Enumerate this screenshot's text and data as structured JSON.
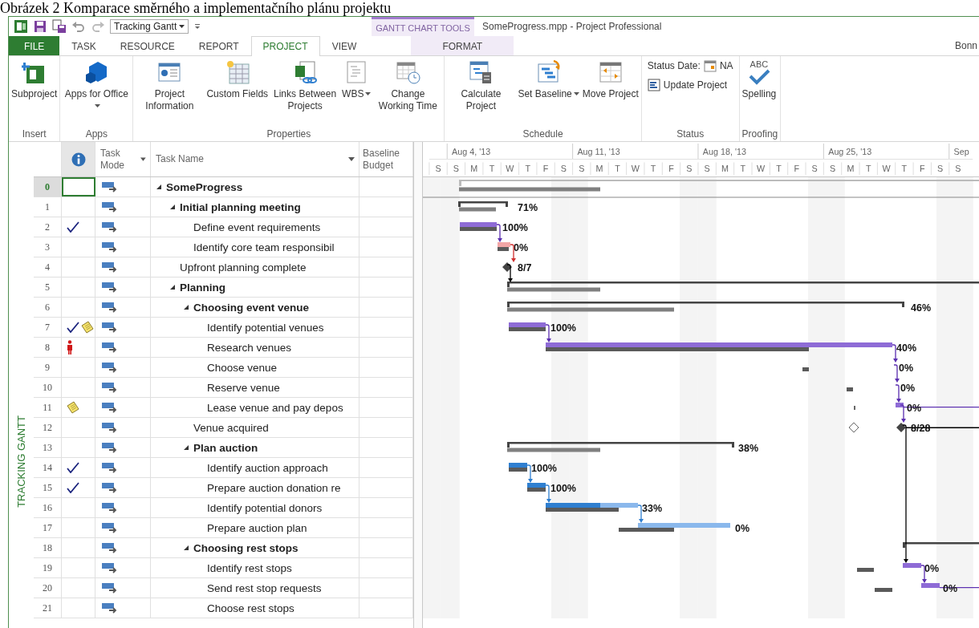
{
  "caption": "Obrázek 2 Komparace směrného a implementačního plánu projektu",
  "view_selector": "Tracking Gantt",
  "contextual_group": "GANTT CHART TOOLS",
  "window_title": "SomeProgress.mpp - Project Professional",
  "user": "Bonn",
  "tabs": [
    {
      "label": "FILE",
      "kind": "file",
      "selected": false
    },
    {
      "label": "TASK",
      "kind": "normal",
      "selected": false
    },
    {
      "label": "RESOURCE",
      "kind": "normal",
      "selected": false
    },
    {
      "label": "REPORT",
      "kind": "normal",
      "selected": false
    },
    {
      "label": "PROJECT",
      "kind": "normal",
      "selected": true
    },
    {
      "label": "VIEW",
      "kind": "normal",
      "selected": false
    },
    {
      "label": "FORMAT",
      "kind": "contextual",
      "selected": false
    }
  ],
  "ribbon_groups": [
    {
      "label": "Insert",
      "commands": [
        {
          "kind": "subproject",
          "label": "Subproject",
          "dropdown": false
        }
      ]
    },
    {
      "label": "Apps",
      "commands": [
        {
          "kind": "apps",
          "label": "Apps for Office",
          "dropdown": true
        }
      ]
    },
    {
      "label": "Properties",
      "commands": [
        {
          "kind": "project-info",
          "label": "Project Information",
          "dropdown": false
        },
        {
          "kind": "custom-fields",
          "label": "Custom Fields",
          "dropdown": false
        },
        {
          "kind": "links",
          "label": "Links Between Projects",
          "dropdown": false
        },
        {
          "kind": "wbs",
          "label": "WBS",
          "dropdown": true
        },
        {
          "kind": "working-time",
          "label": "Change Working Time",
          "dropdown": false
        }
      ]
    },
    {
      "label": "Schedule",
      "commands": [
        {
          "kind": "calculate",
          "label": "Calculate Project",
          "dropdown": false
        },
        {
          "kind": "baseline",
          "label": "Set Baseline",
          "dropdown": true
        },
        {
          "kind": "move",
          "label": "Move Project",
          "dropdown": false
        }
      ]
    },
    {
      "label": "Status",
      "commands": [
        {
          "kind": "status-date",
          "label": "Status Date:",
          "value": "NA"
        },
        {
          "kind": "update",
          "label": "Update Project"
        }
      ]
    },
    {
      "label": "Proofing",
      "commands": [
        {
          "kind": "spelling",
          "label": "Spelling",
          "icon_text": "ABC",
          "dropdown": false
        }
      ]
    }
  ],
  "side_label": "TRACKING GANTT",
  "columns": [
    {
      "kind": "indicators"
    },
    {
      "kind": "mode",
      "label": "Task Mode",
      "filter": true
    },
    {
      "kind": "name",
      "label": "Task Name",
      "filter": true
    },
    {
      "kind": "budget",
      "label": "Baseline Budget"
    }
  ],
  "timescale": {
    "weeks": [
      "Aug 4, '13",
      "Aug 11, '13",
      "Aug 18, '13",
      "Aug 25, '13",
      "Sep"
    ],
    "days": [
      "S",
      "S",
      "M",
      "T",
      "W",
      "T",
      "F",
      "S",
      "S",
      "M",
      "T",
      "W",
      "T",
      "F",
      "S",
      "S",
      "M",
      "T",
      "W",
      "T",
      "F",
      "S",
      "S",
      "M",
      "T",
      "W",
      "T",
      "F",
      "S",
      "S"
    ]
  },
  "tasks": [
    {
      "id": "0",
      "name": "SomeProgress",
      "selected": true,
      "expanded": true,
      "children": [
        {
          "id": "1",
          "name": "Initial planning meeting",
          "selected": false,
          "expanded": true,
          "bar_label": "71%",
          "children": [
            {
              "id": "2",
              "name": "Define event requirements",
              "selected": false,
              "indicators": [
                {
                  "kind": "complete"
                }
              ],
              "bar_label": "100%"
            },
            {
              "id": "3",
              "name": "Identify core team responsibil",
              "selected": false,
              "bar_label": "0%"
            }
          ]
        },
        {
          "id": "4",
          "name": "Upfront planning complete",
          "selected": false,
          "bar_label": "8/7"
        },
        {
          "id": "5",
          "name": "Planning",
          "selected": false,
          "expanded": true,
          "children": [
            {
              "id": "6",
              "name": "Choosing event venue",
              "selected": false,
              "expanded": true,
              "bar_label": "46%",
              "children": [
                {
                  "id": "7",
                  "name": "Identify potential venues",
                  "selected": false,
                  "indicators": [
                    {
                      "kind": "complete"
                    },
                    {
                      "kind": "note"
                    }
                  ],
                  "bar_label": "100%"
                },
                {
                  "id": "8",
                  "name": "Research venues",
                  "selected": false,
                  "indicators": [
                    {
                      "kind": "overallocated"
                    }
                  ],
                  "bar_label": "40%"
                },
                {
                  "id": "9",
                  "name": "Choose venue",
                  "selected": false,
                  "bar_label": "0%"
                },
                {
                  "id": "10",
                  "name": "Reserve venue",
                  "selected": false,
                  "bar_label": "0%"
                },
                {
                  "id": "11",
                  "name": "Lease venue and pay depos",
                  "selected": false,
                  "indicators": [
                    {
                      "kind": "note"
                    }
                  ],
                  "bar_label": "0%"
                }
              ]
            },
            {
              "id": "12",
              "name": "Venue acquired",
              "selected": false,
              "bar_label": "8/28"
            },
            {
              "id": "13",
              "name": "Plan auction",
              "selected": false,
              "expanded": true,
              "bar_label": "38%",
              "children": [
                {
                  "id": "14",
                  "name": "Identify auction approach",
                  "selected": false,
                  "indicators": [
                    {
                      "kind": "complete"
                    }
                  ],
                  "bar_label": "100%"
                },
                {
                  "id": "15",
                  "name": "Prepare auction donation re",
                  "selected": false,
                  "indicators": [
                    {
                      "kind": "complete"
                    }
                  ],
                  "bar_label": "100%"
                },
                {
                  "id": "16",
                  "name": "Identify potential donors",
                  "selected": false,
                  "bar_label": "33%"
                },
                {
                  "id": "17",
                  "name": "Prepare auction plan",
                  "selected": false,
                  "bar_label": "0%"
                }
              ]
            },
            {
              "id": "18",
              "name": "Choosing rest stops",
              "selected": false,
              "expanded": true,
              "children": [
                {
                  "id": "19",
                  "name": "Identify rest stops",
                  "selected": false,
                  "bar_label": "0%"
                },
                {
                  "id": "20",
                  "name": "Send rest stop requests",
                  "selected": false,
                  "bar_label": "0%"
                },
                {
                  "id": "21",
                  "name": "Choose rest stops",
                  "selected": false
                }
              ]
            }
          ]
        }
      ]
    }
  ]
}
